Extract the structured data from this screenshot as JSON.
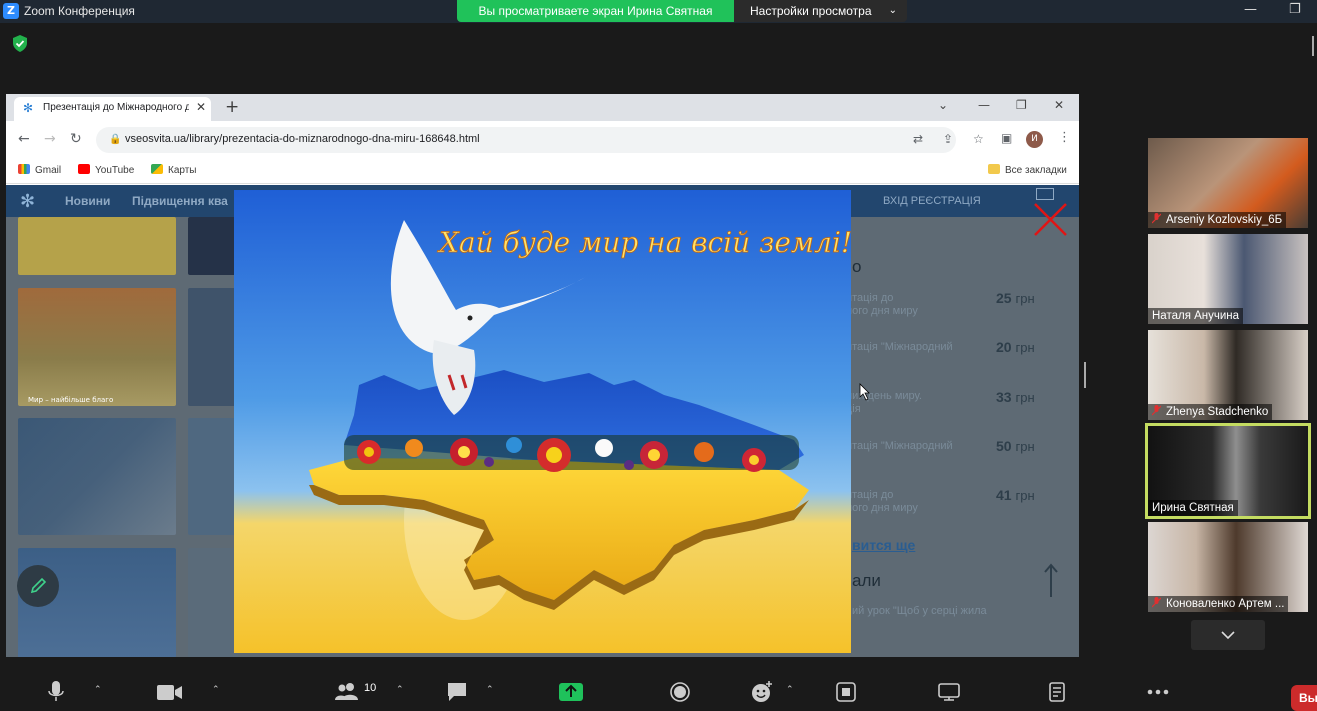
{
  "zoom": {
    "logo_letter": "Z",
    "window_title": "Zoom Конференция",
    "share_notice": "Вы просматриваете экран Ирина Святная",
    "view_options": "Настройки просмотра",
    "leave_label": "Вы"
  },
  "browser": {
    "tab_title": "Презентація до Міжнародного дня миру",
    "url": "vseosvita.ua/library/prezentacia-do-miznarodnogo-dna-miru-168648.html",
    "avatar_letter": "И",
    "bookmarks": [
      {
        "label": "Gmail"
      },
      {
        "label": "YouTube"
      },
      {
        "label": "Карты"
      }
    ],
    "all_bookmarks": "Все закладки"
  },
  "site": {
    "nav_links": [
      "Новини",
      "Підвищення ква"
    ],
    "login": "ВХІД   РЕЄСТРАЦІЯ",
    "side_title": "о",
    "list": [
      {
        "line1": "нтація до",
        "line2": "ного дня миру",
        "price": "25",
        "currency": "грн"
      },
      {
        "line1": "нтація \"Міжнародний",
        "line2": "\"",
        "price": "20",
        "currency": "грн"
      },
      {
        "line1": "ний день миру.",
        "line2": "ція",
        "price": "33",
        "currency": "грн"
      },
      {
        "line1": "нтація \"Міжнародний",
        "line2": "\"",
        "price": "50",
        "currency": "грн"
      },
      {
        "line1": "нтація до",
        "line2": "ного дня миру",
        "price": "41",
        "currency": "грн"
      }
    ],
    "more_link": "вится ще",
    "section_title": "али",
    "section_item": "ий урок \"Щоб у серці жила",
    "thumb_caption": "Мир – найбільше благо"
  },
  "slide": {
    "headline": "Хай буде мир на всій землі!"
  },
  "participants": [
    {
      "name": "Arseniy Kozlovskiy_6Б",
      "muted": true
    },
    {
      "name": "Наталя Анучина",
      "muted": false
    },
    {
      "name": "Zhenya Stadchenko",
      "muted": true
    },
    {
      "name": "Ирина Святная",
      "muted": false,
      "active": true
    },
    {
      "name": "Коноваленко Артем ...",
      "muted": true
    }
  ],
  "toolbar": {
    "participants_count": "10"
  },
  "colors": {
    "share_green": "#20c25a",
    "active_speaker": "#c4dc61",
    "zoom_blue": "#2d8cff",
    "leave_red": "#cc2b2b"
  }
}
